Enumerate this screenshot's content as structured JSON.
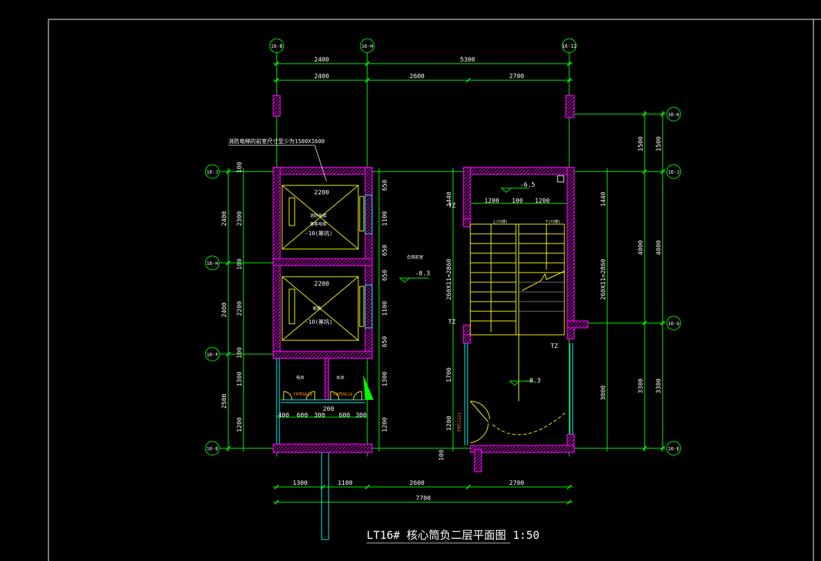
{
  "colors": {
    "background": "#000000",
    "frame": "#ffffff",
    "wall": "#ff00ff",
    "dimension": "#00ff00",
    "stair": "#ffff00",
    "axis": "#00ff00",
    "partition": "#00ffff",
    "door_label": "#ff8800"
  },
  "axes": {
    "top": [
      "16-B",
      "16-H",
      "16-12"
    ],
    "right": [
      "16-K",
      "16-J",
      "16-G",
      "16-E"
    ],
    "left": [
      "16-J",
      "16-H",
      "16-F",
      "16-E"
    ]
  },
  "dimensions": {
    "top_overall": [
      "2400",
      "5300"
    ],
    "top_detail": [
      "2400",
      "2600",
      "2700"
    ],
    "bottom_detail": [
      "1300",
      "1100",
      "2600",
      "2700"
    ],
    "bottom_overall": "7700",
    "left_outer": [
      "2400",
      "2400",
      "2500"
    ],
    "left_inner": [
      "100",
      "2300",
      "100",
      "2200",
      "100",
      "1300",
      "1200"
    ],
    "left_shaft": [
      "650",
      "1100",
      "650",
      "650",
      "1100",
      "650",
      "1300",
      "1200"
    ],
    "bottom_rooms": [
      "400",
      "600",
      "300",
      "600",
      "300"
    ],
    "door_gap": "200",
    "stair_width": [
      "1200",
      "100",
      "1200"
    ],
    "stair_left": [
      "1440",
      "260X11=2860",
      "1700",
      "1200",
      "100"
    ],
    "stair_right_inner": [
      "1440",
      "260X11=2860",
      "3000"
    ],
    "right_outer_a": [
      "1500",
      "4000",
      "3300"
    ],
    "right_outer_b": [
      "1500",
      "4000",
      "3300"
    ]
  },
  "annotations": {
    "shaft_note": "消防电梯的前室尺寸至少为1500X1600",
    "elev1_width": "2200",
    "elev2_width": "2200",
    "elev1_text_a": "消防电梯",
    "elev1_text_b": "兼客电梯",
    "elev1_level": "-10(基坑)",
    "elev2_text": "客梯",
    "elev2_level": "-10(基坑)",
    "corridor_text": "合用前室",
    "corridor_level": "-8.3",
    "room1": "电井",
    "room2": "水井",
    "door1": "FM丙0618",
    "door2": "FM丙0618",
    "stair_level_top": "-6.5",
    "stair_level_bottom": "-8.3",
    "tz1": "TZ",
    "tz2": "TZ",
    "tz3": "TZ",
    "stair_up": "上(Y2楼)",
    "stair_down": "下(Y2楼)",
    "stair_door": "FM乙1221"
  },
  "title": "LT16#  核心筒负二层平面图 1:50"
}
